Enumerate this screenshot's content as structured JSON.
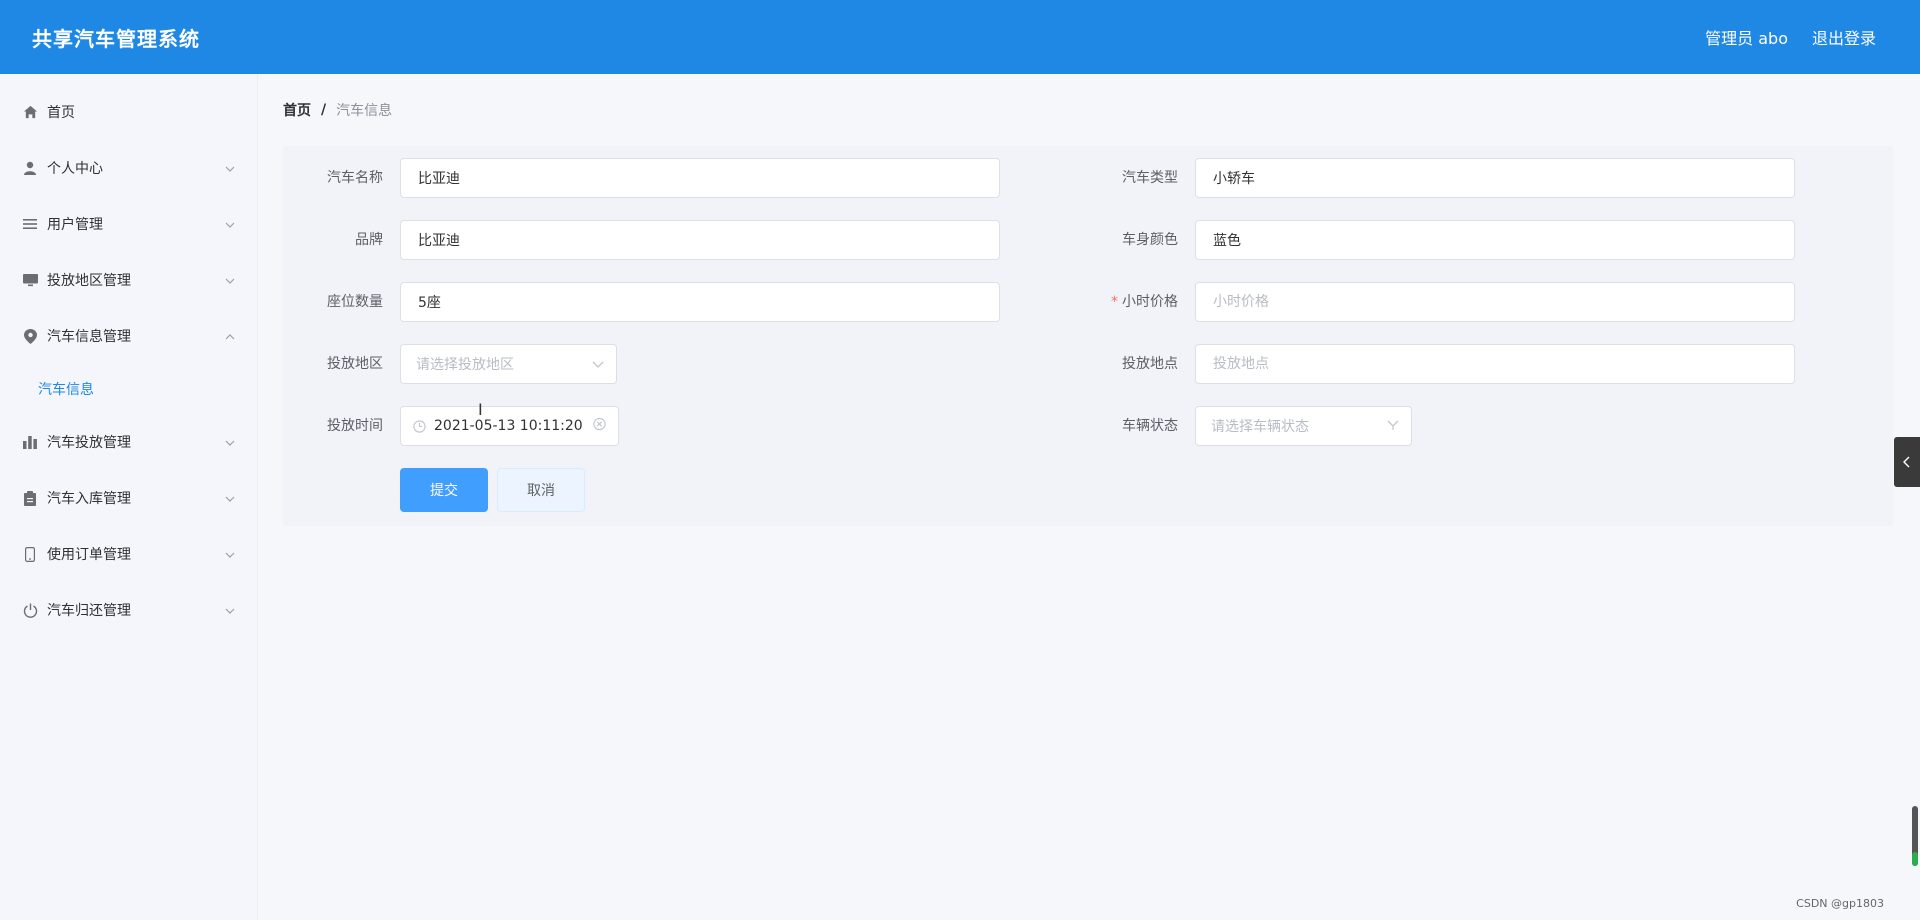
{
  "header": {
    "app_title": "共享汽车管理系统",
    "user_label": "管理员 abo",
    "logout_label": "退出登录",
    "bg_color": "#1f88e5"
  },
  "sidebar": {
    "items": [
      {
        "label": "首页",
        "icon": "home-icon",
        "expandable": false
      },
      {
        "label": "个人中心",
        "icon": "user-icon",
        "expandable": true
      },
      {
        "label": "用户管理",
        "icon": "list-icon",
        "expandable": true
      },
      {
        "label": "投放地区管理",
        "icon": "monitor-icon",
        "expandable": true
      },
      {
        "label": "汽车信息管理",
        "icon": "location-icon",
        "expandable": true,
        "expanded": true
      },
      {
        "label": "汽车投放管理",
        "icon": "bar-chart-icon",
        "expandable": true
      },
      {
        "label": "汽车入库管理",
        "icon": "clipboard-icon",
        "expandable": true
      },
      {
        "label": "使用订单管理",
        "icon": "phone-icon",
        "expandable": true
      },
      {
        "label": "汽车归还管理",
        "icon": "power-icon",
        "expandable": true
      }
    ],
    "submenu": {
      "label": "汽车信息",
      "active_color": "#1f88e5"
    }
  },
  "breadcrumb": {
    "home": "首页",
    "separator": "/",
    "current": "汽车信息"
  },
  "form": {
    "car_name": {
      "label": "汽车名称",
      "value": "比亚迪"
    },
    "car_type": {
      "label": "汽车类型",
      "value": "小轿车"
    },
    "brand": {
      "label": "品牌",
      "value": "比亚迪"
    },
    "body_color": {
      "label": "车身颜色",
      "value": "蓝色"
    },
    "seats": {
      "label": "座位数量",
      "value": "5座"
    },
    "hourly_price": {
      "label": "小时价格",
      "required": "*",
      "value": "",
      "placeholder": "小时价格"
    },
    "region": {
      "label": "投放地区",
      "placeholder": "请选择投放地区",
      "icon": "chevron-down-icon"
    },
    "location": {
      "label": "投放地点",
      "value": "",
      "placeholder": "投放地点"
    },
    "release_time": {
      "label": "投放时间",
      "value": "2021-05-13 10:11:20",
      "prefix_icon": "clock-icon",
      "suffix_icon": "clear-icon"
    },
    "vehicle_status": {
      "label": "车辆状态",
      "placeholder": "请选择车辆状态",
      "icon": "chevron-down-icon"
    },
    "submit_label": "提交",
    "cancel_label": "取消"
  },
  "watermark": "CSDN @gp1803"
}
